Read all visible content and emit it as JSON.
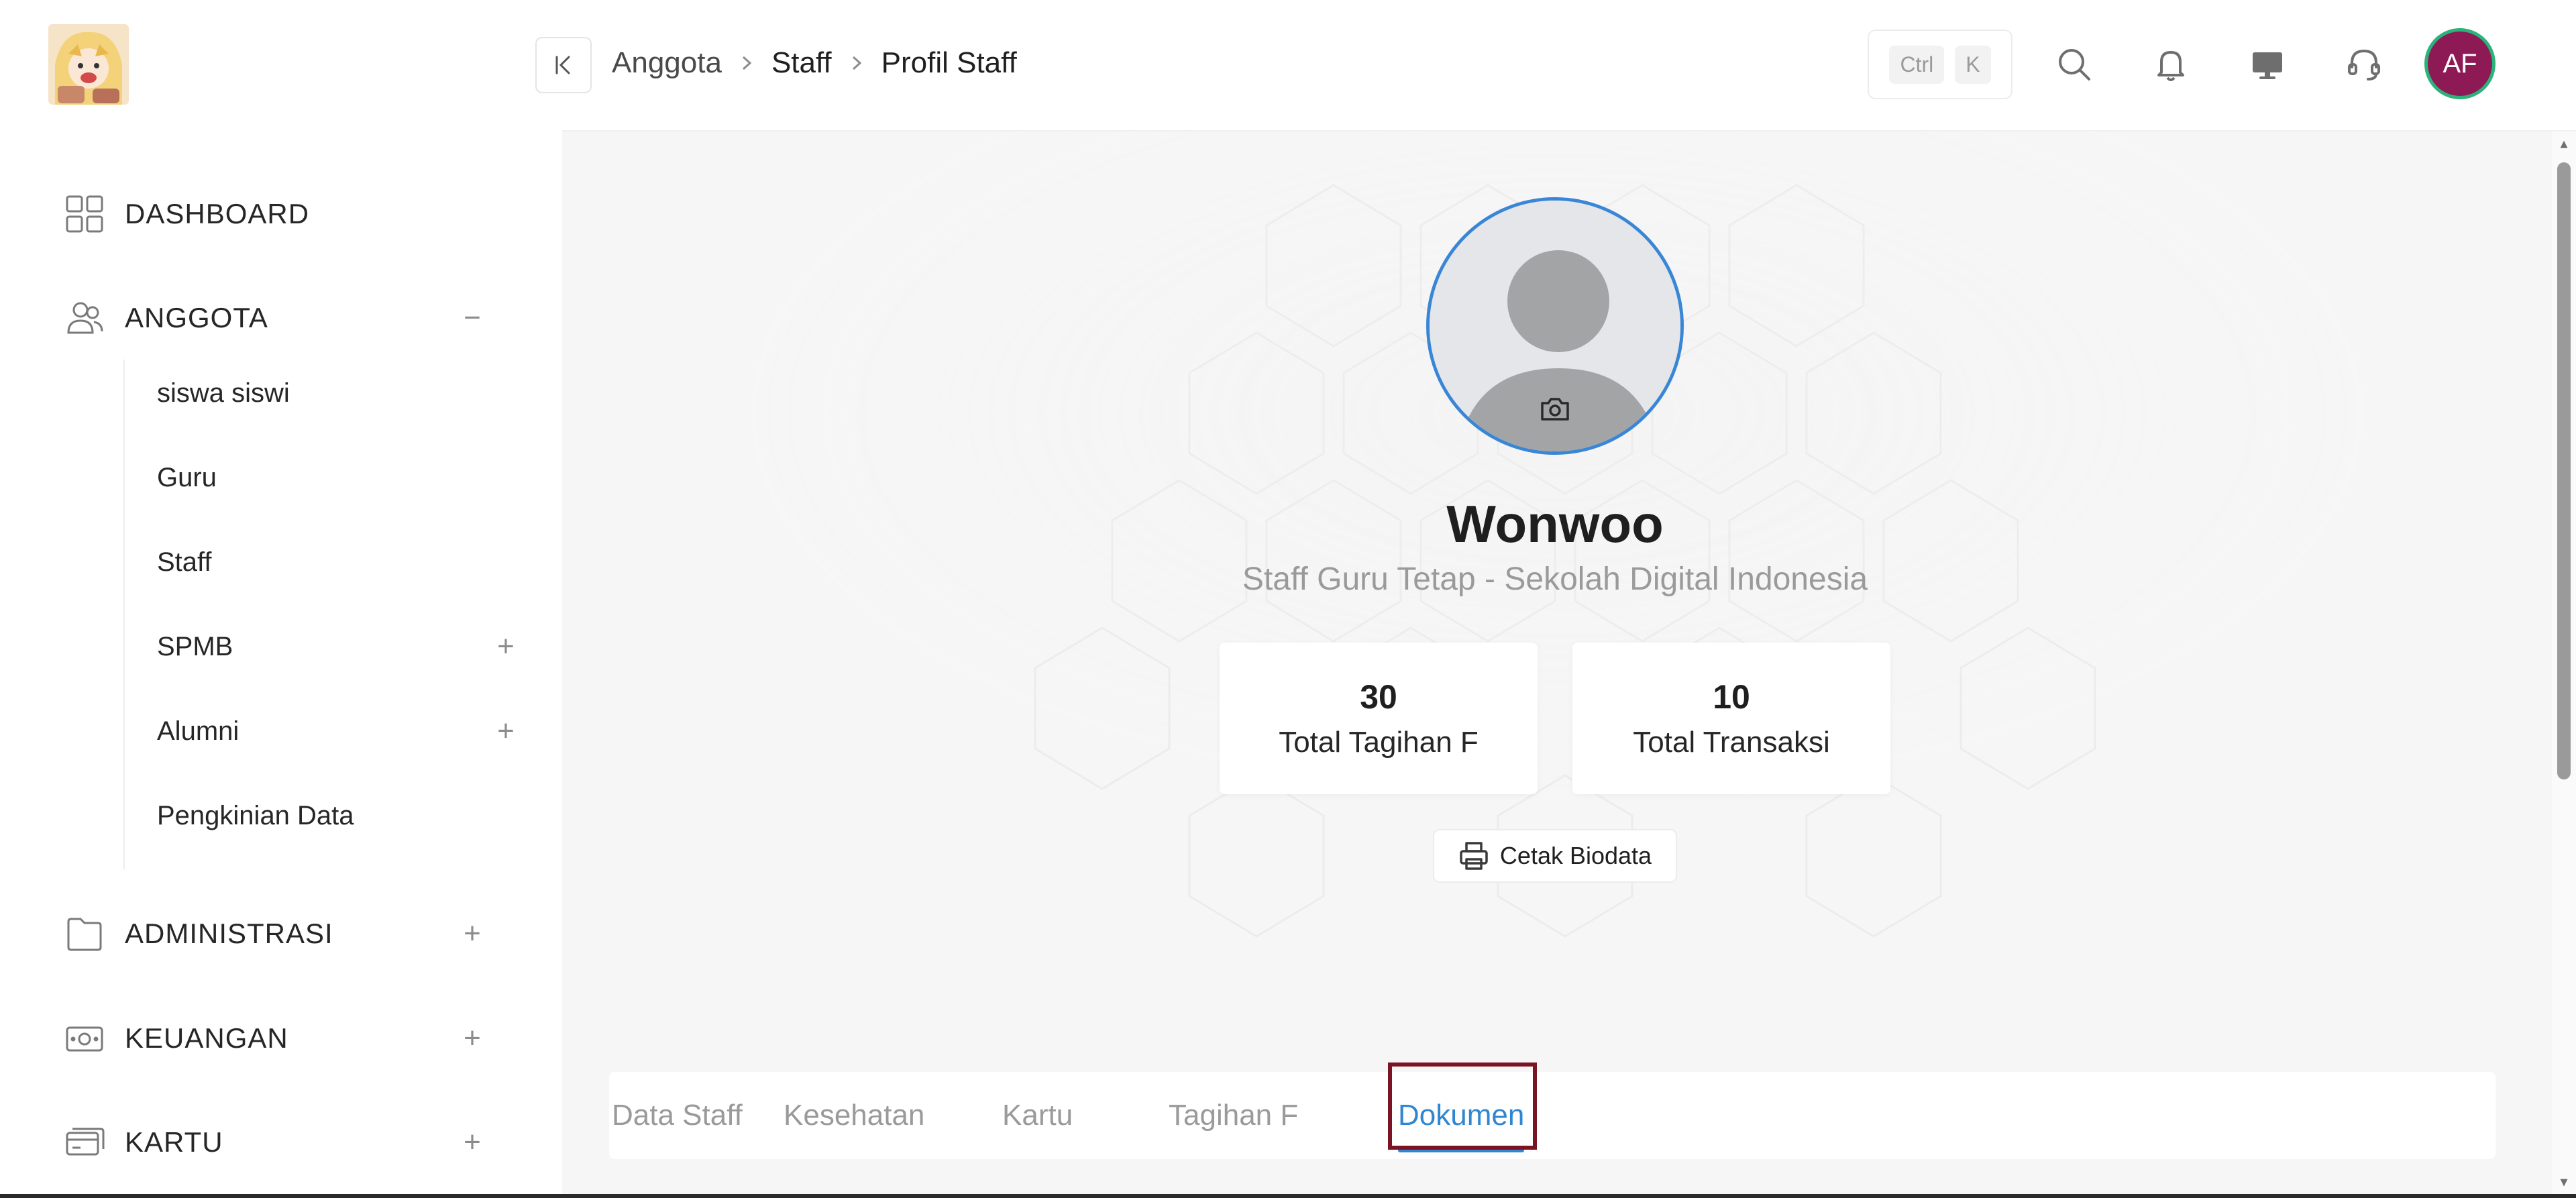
{
  "breadcrumb": [
    "Anggota",
    "Staff",
    "Profil Staff"
  ],
  "shortcut": {
    "mod": "Ctrl",
    "key": "K"
  },
  "user": {
    "initials": "AF",
    "avatar_bg": "#8e1a55",
    "avatar_ring": "#2bb37a"
  },
  "sidebar": {
    "sections": [
      {
        "label": "DASHBOARD",
        "icon": "grid-icon",
        "toggle": ""
      },
      {
        "label": "ANGGOTA",
        "icon": "users-icon",
        "toggle": "−"
      },
      {
        "label": "ADMINISTRASI",
        "icon": "folder-icon",
        "toggle": "+"
      },
      {
        "label": "KEUANGAN",
        "icon": "money-icon",
        "toggle": "+"
      },
      {
        "label": "KARTU",
        "icon": "card-icon",
        "toggle": "+"
      }
    ],
    "anggota_items": [
      {
        "label": "siswa siswi",
        "toggle": ""
      },
      {
        "label": "Guru",
        "toggle": ""
      },
      {
        "label": "Staff",
        "toggle": ""
      },
      {
        "label": "SPMB",
        "toggle": "+"
      },
      {
        "label": "Alumni",
        "toggle": "+"
      },
      {
        "label": "Pengkinian Data",
        "toggle": ""
      }
    ]
  },
  "profile": {
    "name": "Wonwoo",
    "subtitle": "Staff Guru Tetap - Sekolah Digital Indonesia",
    "stats": [
      {
        "value": "30",
        "label": "Total Tagihan F"
      },
      {
        "value": "10",
        "label": "Total Transaksi"
      }
    ],
    "print_label": "Cetak Biodata"
  },
  "tabs": [
    {
      "label": "Data Staff",
      "active": false
    },
    {
      "label": "Kesehatan",
      "active": false
    },
    {
      "label": "Kartu",
      "active": false
    },
    {
      "label": "Tagihan F",
      "active": false
    },
    {
      "label": "Dokumen",
      "active": true
    }
  ],
  "colors": {
    "accent": "#2f86d1",
    "highlight": "#7a1424",
    "photo_ring": "#3a86d6"
  }
}
